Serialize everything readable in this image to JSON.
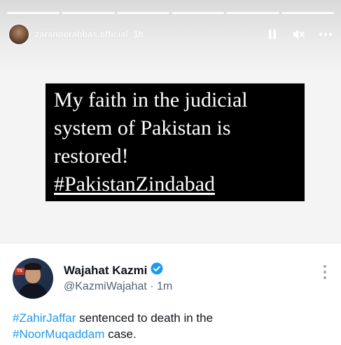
{
  "story": {
    "progress_segments": 6,
    "username": "zaranoorabbas.official",
    "time": "1h",
    "icons": [
      "pause-icon",
      "mute-icon",
      "more-icon"
    ]
  },
  "quote": {
    "line1": "My faith in the judicial",
    "line2": "system of Pakistan is",
    "line3": "restored!",
    "hashtag": "#PakistanZindabad"
  },
  "tweet": {
    "name": "Wajahat Kazmi",
    "handle": "@KazmiWajahat",
    "separator": "·",
    "time": "1m",
    "hashtag1": "#ZahirJaffar",
    "text1": " sentenced to death in the",
    "hashtag2": "#NoorMuqaddam",
    "text2": " case.",
    "avatar_badge": "TS",
    "verified_color": "#1d9bf0"
  }
}
